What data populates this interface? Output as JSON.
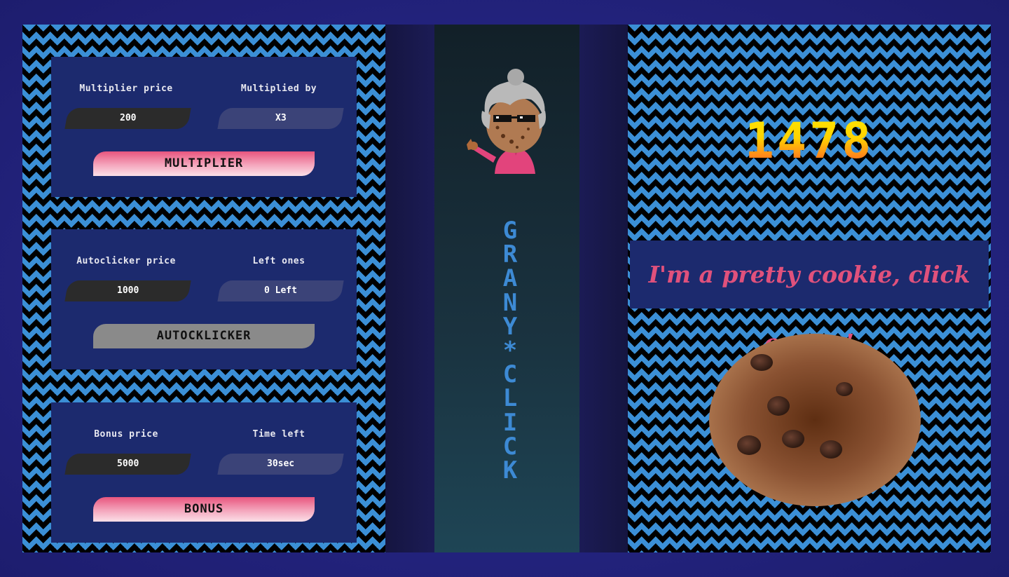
{
  "app": {
    "title": "GRANY*CLICK"
  },
  "score": "1478",
  "message": "I'm a pretty cookie, click on me!",
  "panels": {
    "multiplier": {
      "price_label": "Multiplier price",
      "price_value": "200",
      "info_label": "Multiplied by",
      "info_value": "X3",
      "button_label": "MULTIPLIER"
    },
    "autoclicker": {
      "price_label": "Autoclicker price",
      "price_value": "1000",
      "info_label": "Left ones",
      "info_value": "0 Left",
      "button_label": "AUTOCKLICKER"
    },
    "bonus": {
      "price_label": "Bonus price",
      "price_value": "5000",
      "info_label": "Time left",
      "info_value": "30sec",
      "button_label": "BONUS"
    }
  },
  "colors": {
    "frame": "#2a2a8a",
    "zigzag": "#3b8fd6",
    "panel": "#1c2a6e",
    "button_active": "#e8557e",
    "button_disabled": "#8a8a8a",
    "title": "#3d8ad4",
    "message": "#e0517c"
  },
  "icons": {
    "granny": "granny-sunglasses-icon",
    "cookie": "cookie-icon"
  }
}
